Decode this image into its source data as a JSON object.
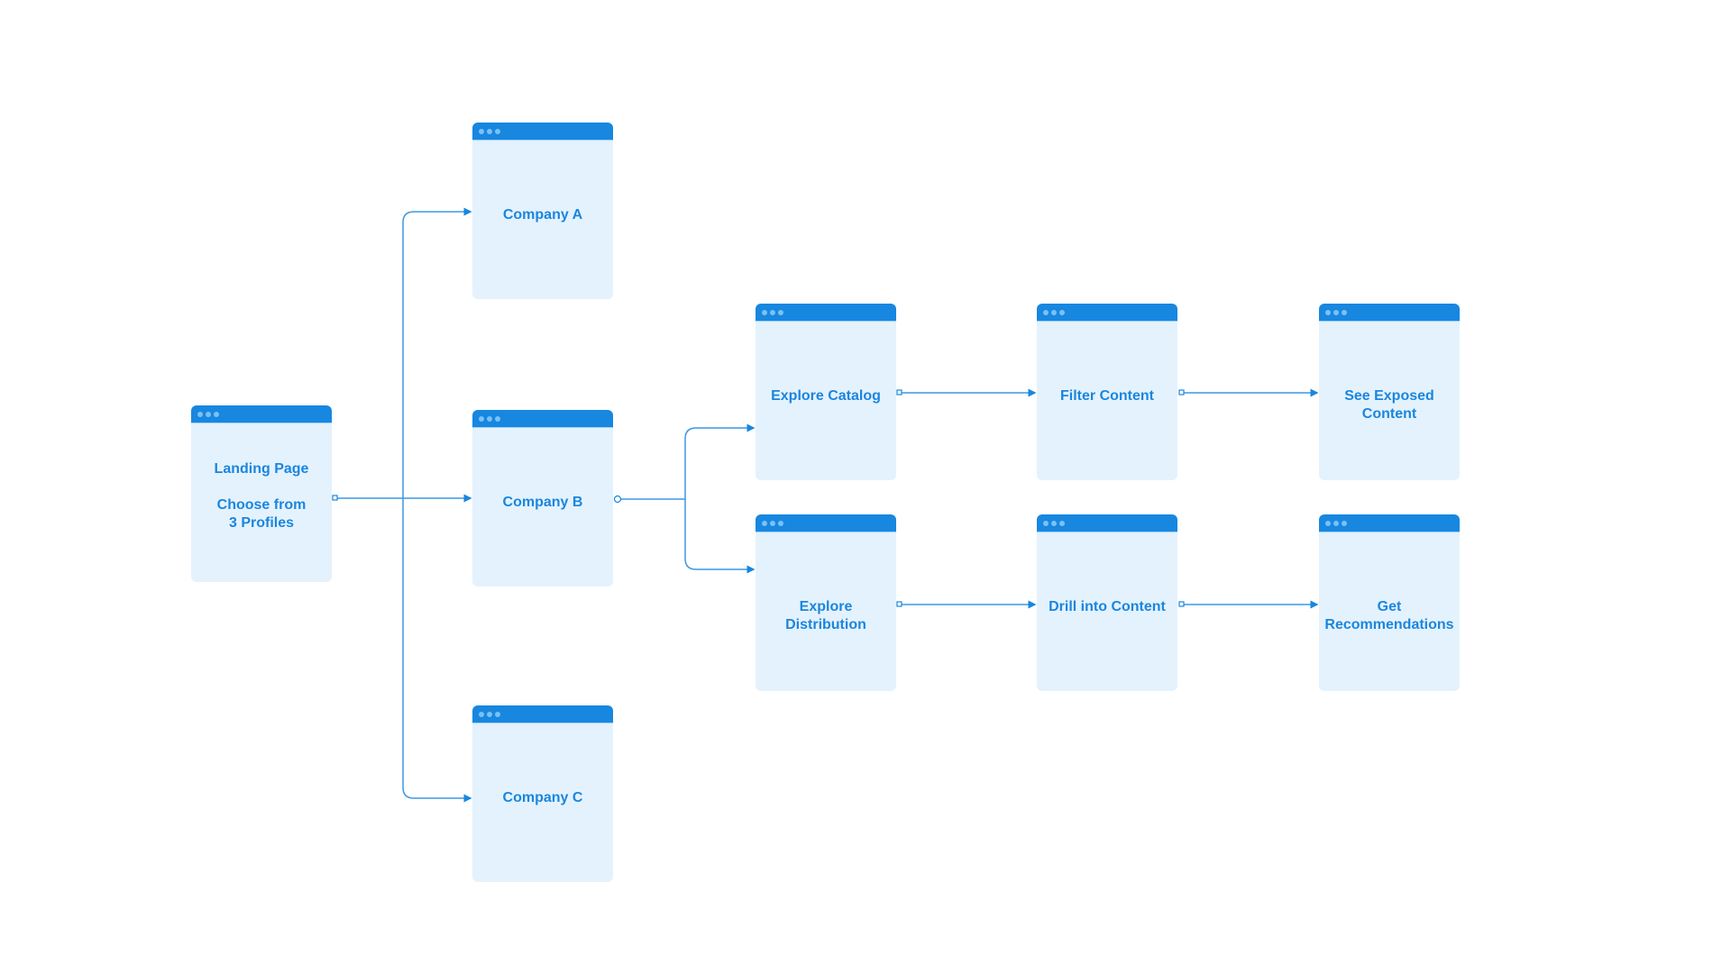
{
  "colors": {
    "header": "#1787e0",
    "body": "#e4f2fe",
    "text": "#1a86de",
    "connector": "#3d97e3"
  },
  "nodes": [
    {
      "id": "landing",
      "lines": [
        "Landing Page",
        "",
        "Choose from",
        "3 Profiles"
      ]
    },
    {
      "id": "company-a",
      "lines": [
        "Company A"
      ]
    },
    {
      "id": "company-b",
      "lines": [
        "Company B"
      ]
    },
    {
      "id": "company-c",
      "lines": [
        "Company C"
      ]
    },
    {
      "id": "explore-catalog",
      "lines": [
        "Explore Catalog"
      ]
    },
    {
      "id": "explore-distribution",
      "lines": [
        "Explore",
        "Distribution"
      ]
    },
    {
      "id": "filter-content",
      "lines": [
        "Filter Content"
      ]
    },
    {
      "id": "drill-into-content",
      "lines": [
        "Drill into Content"
      ]
    },
    {
      "id": "see-exposed-content",
      "lines": [
        "See Exposed",
        "Content"
      ]
    },
    {
      "id": "get-recommendations",
      "lines": [
        "Get",
        "Recommendations"
      ]
    }
  ],
  "edges": [
    [
      "landing",
      "company-a"
    ],
    [
      "landing",
      "company-b"
    ],
    [
      "landing",
      "company-c"
    ],
    [
      "company-b",
      "explore-catalog"
    ],
    [
      "company-b",
      "explore-distribution"
    ],
    [
      "explore-catalog",
      "filter-content"
    ],
    [
      "filter-content",
      "see-exposed-content"
    ],
    [
      "explore-distribution",
      "drill-into-content"
    ],
    [
      "drill-into-content",
      "get-recommendations"
    ]
  ]
}
